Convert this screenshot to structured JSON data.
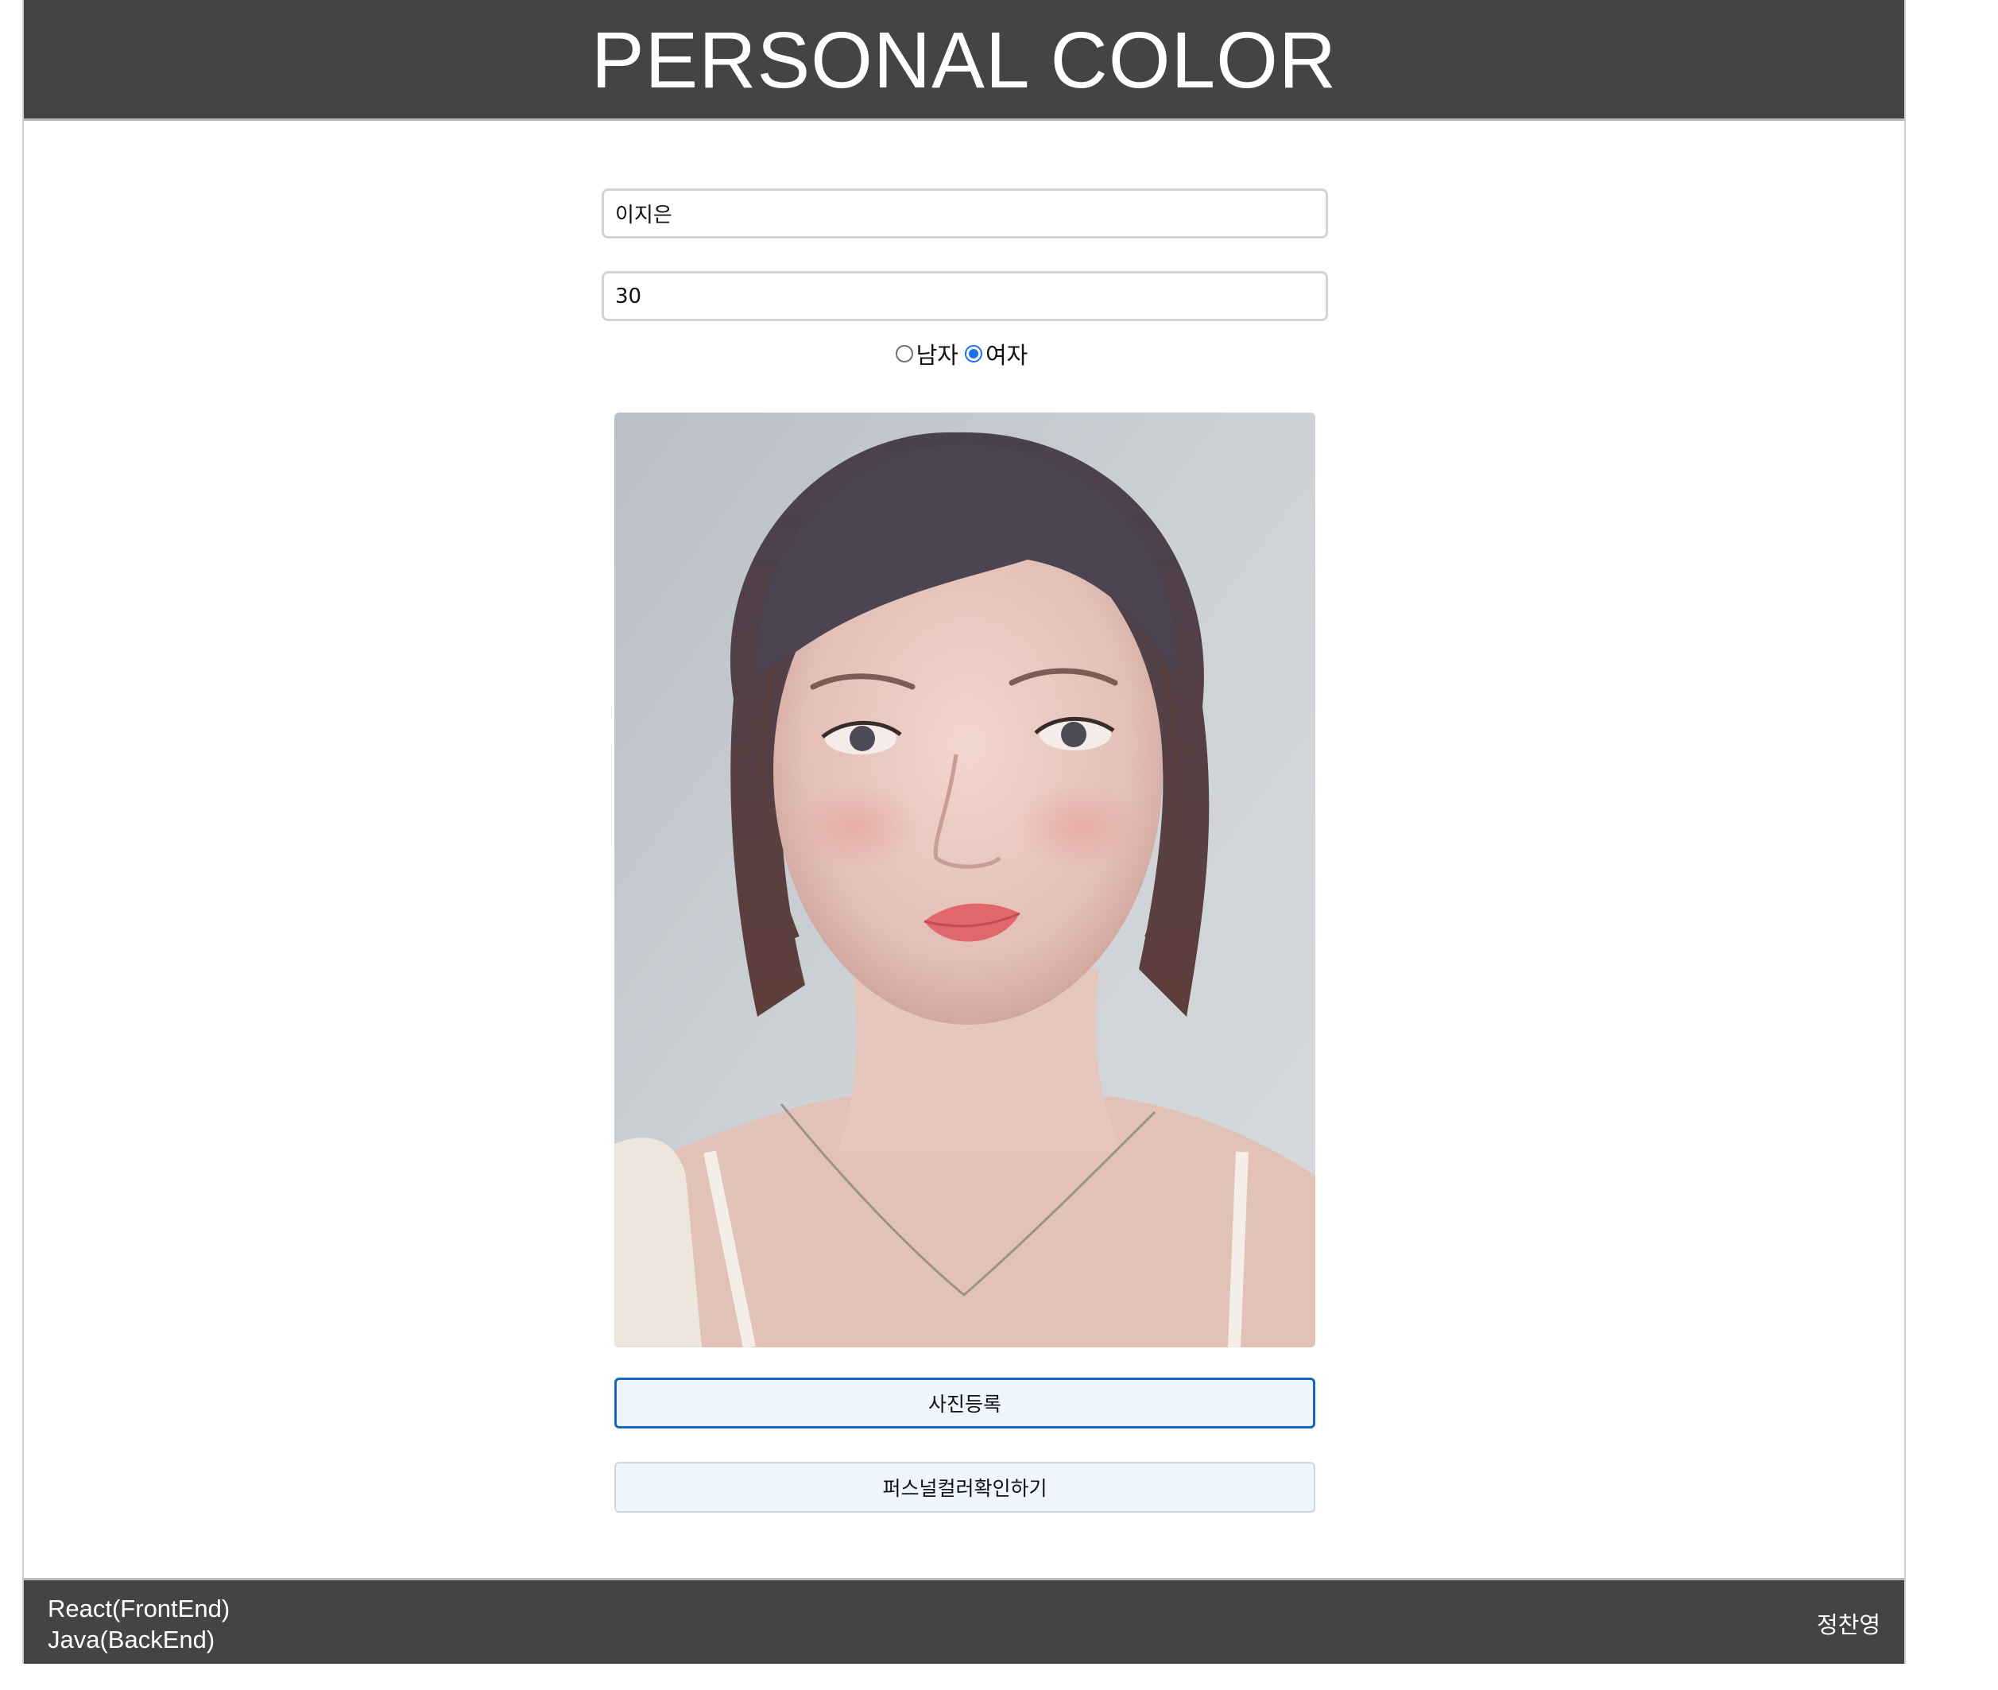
{
  "header": {
    "title": "PERSONAL COLOR"
  },
  "form": {
    "name_value": "이지은",
    "age_value": "30",
    "gender": {
      "options": [
        {
          "label": "남자",
          "checked": false
        },
        {
          "label": "여자",
          "checked": true
        }
      ]
    },
    "photo": {
      "icon": "portrait-photo"
    },
    "upload_label": "사진등록",
    "check_label": "퍼스널컬러확인하기"
  },
  "footer": {
    "frontend": "React(FrontEnd)",
    "backend": "Java(BackEnd)",
    "author": "정찬영"
  },
  "colors": {
    "header_bg": "#444444",
    "button_bg": "#eef5fd",
    "focus_border": "#1666c2",
    "radio_accent": "#1a73e8"
  }
}
